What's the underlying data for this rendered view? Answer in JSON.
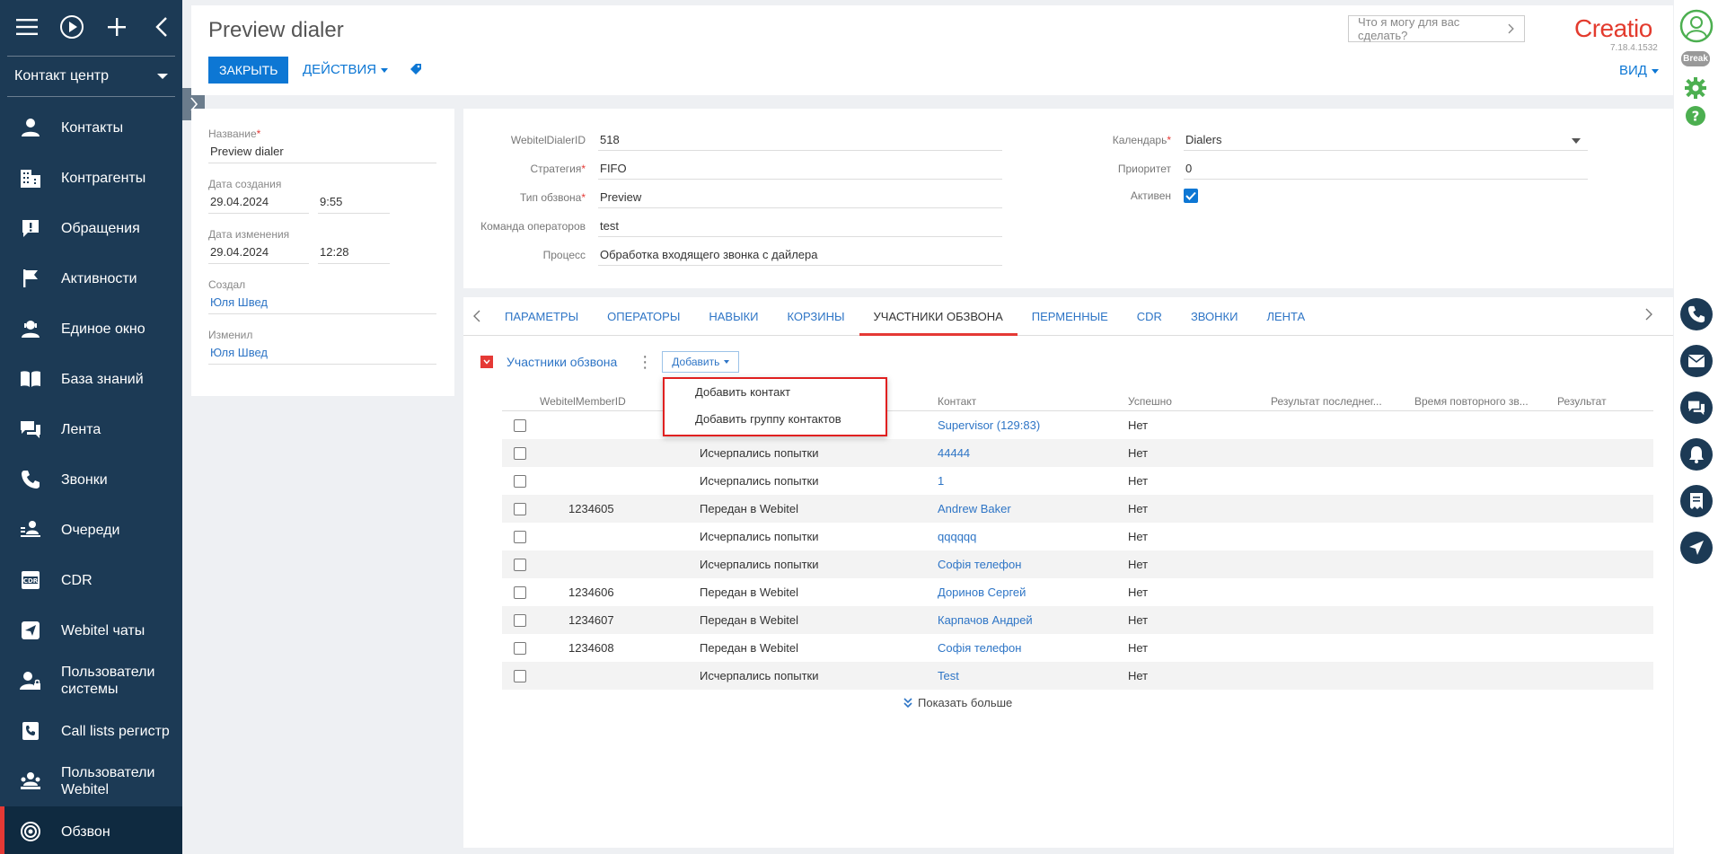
{
  "sidebar": {
    "workspace": "Контакт центр",
    "items": [
      {
        "label": "Контакты",
        "icon": "contact-icon"
      },
      {
        "label": "Контрагенты",
        "icon": "building-icon"
      },
      {
        "label": "Обращения",
        "icon": "alert-case-icon"
      },
      {
        "label": "Активности",
        "icon": "flag-icon"
      },
      {
        "label": "Единое окно",
        "icon": "agent-icon"
      },
      {
        "label": "База знаний",
        "icon": "book-icon"
      },
      {
        "label": "Лента",
        "icon": "chat-icon"
      },
      {
        "label": "Звонки",
        "icon": "phone-icon"
      },
      {
        "label": "Очереди",
        "icon": "queue-icon"
      },
      {
        "label": "CDR",
        "icon": "cdr-icon"
      },
      {
        "label": "Webitel чаты",
        "icon": "send-icon"
      },
      {
        "label": "Пользователи системы",
        "icon": "user-lock-icon"
      },
      {
        "label": "Call lists регистр",
        "icon": "call-list-icon"
      },
      {
        "label": "Пользователи Webitel",
        "icon": "user-group-icon"
      },
      {
        "label": "Обзвон",
        "icon": "dialer-icon"
      }
    ]
  },
  "header": {
    "title": "Preview dialer",
    "close_label": "ЗАКРЫТЬ",
    "actions_label": "ДЕЙСТВИЯ",
    "search_placeholder": "Что я могу для вас сделать?",
    "logo": "Creatio",
    "version": "7.18.4.1532",
    "view_label": "ВИД"
  },
  "profile": {
    "name_label": "Название",
    "name_value": "Preview dialer",
    "created_label": "Дата создания",
    "created_date": "29.04.2024",
    "created_time": "9:55",
    "modified_label": "Дата изменения",
    "modified_date": "29.04.2024",
    "modified_time": "12:28",
    "author_label": "Создал",
    "author_value": "Юля Швед",
    "editor_label": "Изменил",
    "editor_value": "Юля Швед"
  },
  "fields": {
    "dialer_id_label": "WebitelDialerID",
    "dialer_id_value": "518",
    "strategy_label": "Стратегия",
    "strategy_value": "FIFO",
    "type_label": "Тип обзвона",
    "type_value": "Preview",
    "team_label": "Команда операторов",
    "team_value": "test",
    "process_label": "Процесс",
    "process_value": "Обработка входящего звонка с дайлера",
    "calendar_label": "Календарь",
    "calendar_value": "Dialers",
    "priority_label": "Приоритет",
    "priority_value": "0",
    "active_label": "Активен",
    "active_value": true
  },
  "tabs": [
    "ПАРАМЕТРЫ",
    "ОПЕРАТОРЫ",
    "НАВЫКИ",
    "КОРЗИНЫ",
    "УЧАСТНИКИ ОБЗВОНА",
    "ПЕРМЕННЫЕ",
    "CDR",
    "ЗВОНКИ",
    "ЛЕНТА"
  ],
  "active_tab": "УЧАСТНИКИ ОБЗВОНА",
  "detail": {
    "title": "Участники обзвона",
    "add_label": "Добавить",
    "menu": [
      "Добавить контакт",
      "Добавить группу контактов"
    ],
    "columns": [
      "WebitelMemberID",
      "",
      "Контакт",
      "Успешно",
      "Результат последнег...",
      "Время повторного зв...",
      "Результат"
    ],
    "rows": [
      {
        "id": "",
        "status": "",
        "contact": "Supervisor (129:83)",
        "success": "Нет"
      },
      {
        "id": "",
        "status": "Исчерпались попытки",
        "contact": "44444",
        "success": "Нет"
      },
      {
        "id": "",
        "status": "Исчерпались попытки",
        "contact": "1",
        "success": "Нет"
      },
      {
        "id": "1234605",
        "status": "Передан в Webitel",
        "contact": "Andrew Baker",
        "success": "Нет"
      },
      {
        "id": "",
        "status": "Исчерпались попытки",
        "contact": "qqqqqq",
        "success": "Нет"
      },
      {
        "id": "",
        "status": "Исчерпались попытки",
        "contact": "Софія телефон",
        "success": "Нет"
      },
      {
        "id": "1234606",
        "status": "Передан в Webitel",
        "contact": "Доринов Сергей",
        "success": "Нет"
      },
      {
        "id": "1234607",
        "status": "Передан в Webitel",
        "contact": "Карпачов Андрей",
        "success": "Нет"
      },
      {
        "id": "1234608",
        "status": "Передан в Webitel",
        "contact": "Софія телефон",
        "success": "Нет"
      },
      {
        "id": "",
        "status": "Исчерпались попытки",
        "contact": "Test",
        "success": "Нет"
      }
    ],
    "show_more": "Показать больше"
  },
  "rail": {
    "break_label": "Break"
  },
  "colors": {
    "sidebar_bg": "#1c3a55",
    "accent_blue": "#0d77d4",
    "accent_red": "#e53935",
    "link": "#2e75c6"
  }
}
